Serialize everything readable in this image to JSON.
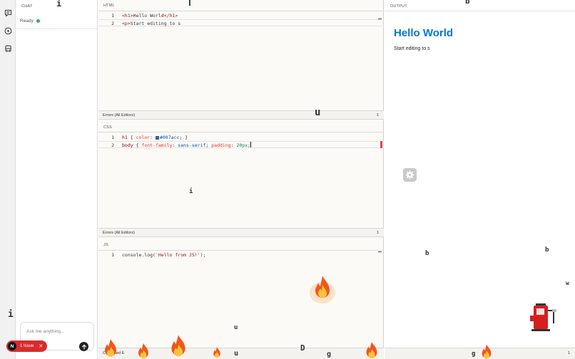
{
  "chat": {
    "title": "CHAT",
    "status": "Ready",
    "input_placeholder": "Ask me anything..."
  },
  "issues": {
    "logo": "N",
    "label": "1 Issue"
  },
  "editors": {
    "html": {
      "label": "HTML",
      "lines": [
        {
          "num": "1",
          "parts": [
            [
              "tag",
              "<h1>"
            ],
            [
              "plain",
              "Hello World"
            ],
            [
              "tag",
              "</h1>"
            ]
          ]
        },
        {
          "num": "2",
          "parts": [
            [
              "tag",
              "<p>"
            ],
            [
              "plain",
              "Start editing to s"
            ]
          ]
        }
      ],
      "errors_label": "Errors (All Editors)",
      "errors_count": "1"
    },
    "css": {
      "label": "CSS",
      "lines": [
        {
          "num": "1",
          "parts": [
            [
              "sel",
              "h1"
            ],
            [
              "plain",
              " { "
            ],
            [
              "prop",
              "color"
            ],
            [
              "plain",
              ": "
            ],
            [
              "swatch",
              "#007acc"
            ],
            [
              "val",
              "#007acc"
            ],
            [
              "plain",
              "; }"
            ]
          ]
        },
        {
          "num": "2",
          "parts": [
            [
              "sel",
              "body"
            ],
            [
              "plain",
              " { "
            ],
            [
              "prop",
              "font-family"
            ],
            [
              "plain",
              ": "
            ],
            [
              "val",
              "sans-serif"
            ],
            [
              "plain",
              "; "
            ],
            [
              "prop",
              "padding"
            ],
            [
              "plain",
              ": "
            ],
            [
              "num",
              "20px"
            ],
            [
              "plain",
              ";"
            ],
            [
              "caret",
              ""
            ]
          ]
        }
      ],
      "errors_label": "Errors (All Editors)",
      "errors_count": "1"
    },
    "js": {
      "label": "JS",
      "lines": [
        {
          "num": "1",
          "parts": [
            [
              "plain",
              "console.log("
            ],
            [
              "str",
              "'Hello from JS!'"
            ],
            [
              "plain",
              ");"
            ]
          ]
        }
      ]
    },
    "combined_label": "Combined E"
  },
  "output": {
    "label": "OUTPUT",
    "h1": "Hello World",
    "p": "Start editing to s",
    "bottom_count": "1"
  },
  "overlay_letters": [
    "i",
    "T",
    "u",
    "i",
    "b",
    "b",
    "w",
    "i",
    "u",
    "D",
    "u",
    "g",
    "g",
    "b"
  ],
  "colors": {
    "accent": "#007acc",
    "status_green": "#2fb24a",
    "issue_red": "#d92b2b",
    "error_mark": "#e04848"
  },
  "icons": [
    "chat-icon",
    "play-circle-icon",
    "bus-icon",
    "send-arrow-icon",
    "gear-icon",
    "fire-icon",
    "fuel-pump-icon",
    "close-icon"
  ]
}
